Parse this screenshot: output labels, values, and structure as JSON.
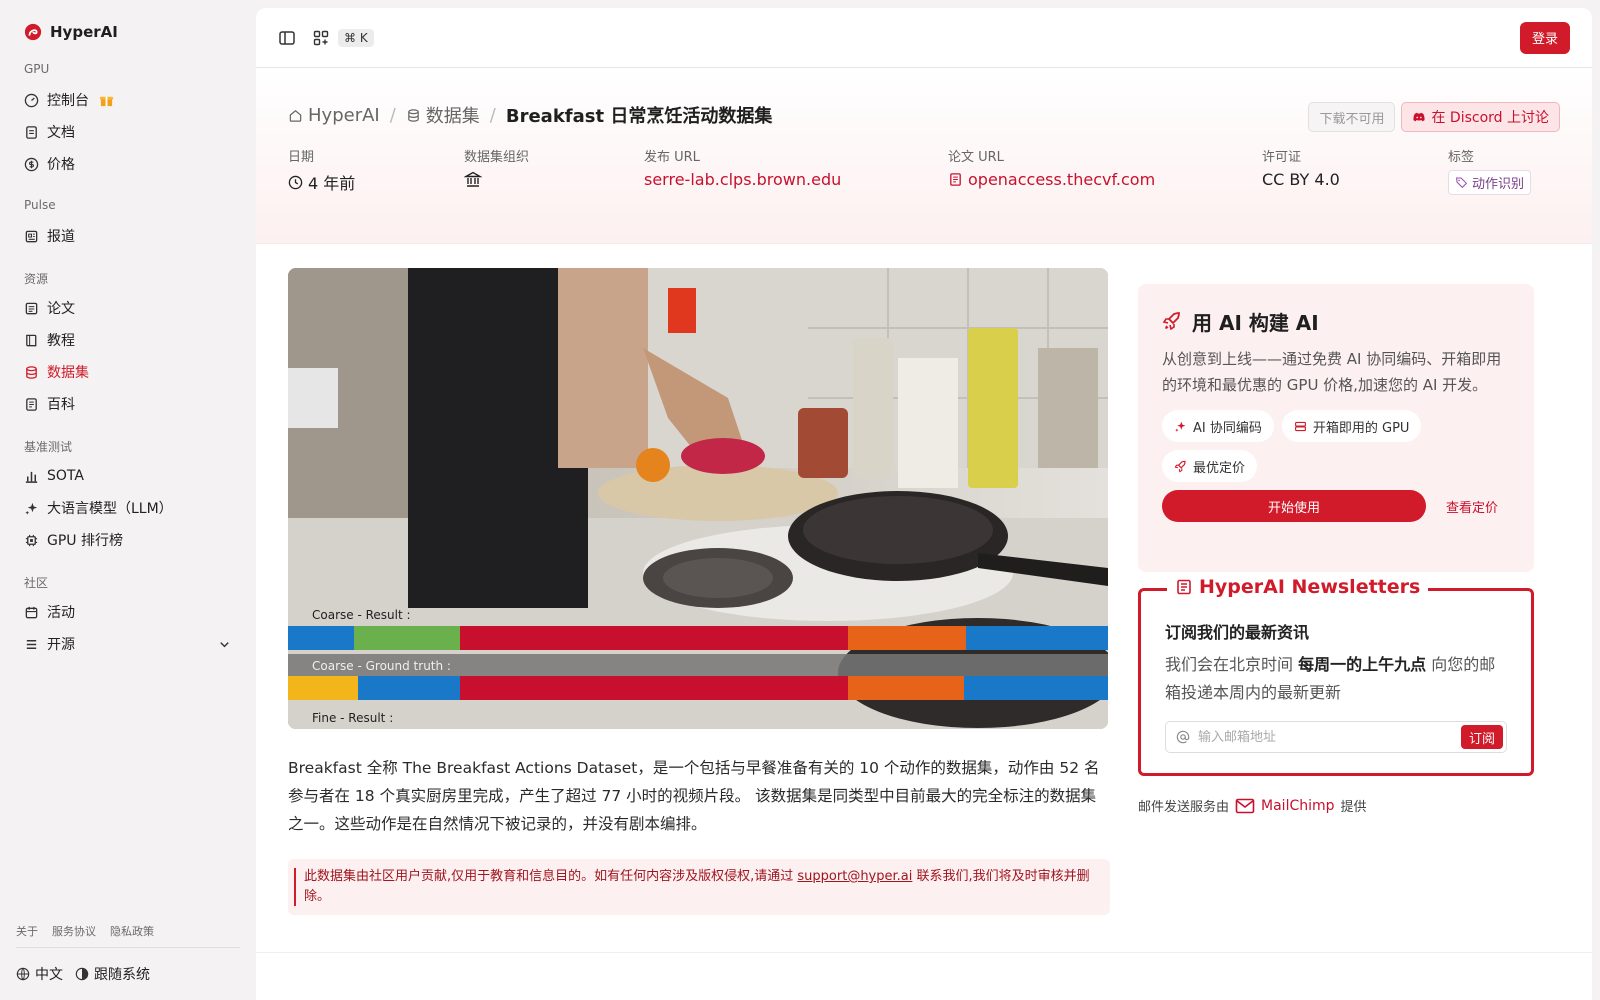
{
  "sidebar": {
    "brand": "HyperAI",
    "groups": [
      {
        "title": "GPU",
        "items": [
          {
            "label": "控制台"
          },
          {
            "label": "文档"
          },
          {
            "label": "价格"
          }
        ]
      },
      {
        "title": "Pulse",
        "items": [
          {
            "label": "报道"
          }
        ]
      },
      {
        "title": "资源",
        "items": [
          {
            "label": "论文"
          },
          {
            "label": "教程"
          },
          {
            "label": "数据集"
          },
          {
            "label": "百科"
          }
        ]
      },
      {
        "title": "基准测试",
        "items": [
          {
            "label": "SOTA"
          },
          {
            "label": "大语言模型（LLM）"
          },
          {
            "label": "GPU 排行榜"
          }
        ]
      },
      {
        "title": "社区",
        "items": [
          {
            "label": "活动"
          },
          {
            "label": "开源"
          }
        ]
      }
    ],
    "footer_links": [
      "关于",
      "服务协议",
      "隐私政策"
    ],
    "language": "中文",
    "theme": "跟随系统"
  },
  "topbar": {
    "shortcut": "⌘ K",
    "login": "登录"
  },
  "hero": {
    "breadcrumb": [
      "HyperAI",
      "数据集",
      "Breakfast 日常烹饪活动数据集"
    ],
    "separator": "/",
    "download_label": "下载不可用",
    "discord_label": "在 Discord 上讨论",
    "meta": {
      "date_label": "日期",
      "date_value": "4 年前",
      "org_label": "数据集组织",
      "publish_label": "发布 URL",
      "publish_value": "serre-lab.clps.brown.edu",
      "paper_label": "论文 URL",
      "paper_value": "openaccess.thecvf.com",
      "license_label": "许可证",
      "license_value": "CC BY 4.0",
      "tags_label": "标签",
      "tag_value": "动作识别"
    }
  },
  "preview": {
    "labels": [
      "Coarse - Result :",
      "Coarse - Ground truth :",
      "Fine - Result :"
    ],
    "colors": [
      "#1a78c8",
      "#6ab04c",
      "#c8102e",
      "#e8631a",
      "#f2b61b",
      "#777777"
    ]
  },
  "description": "Breakfast 全称 The Breakfast Actions Dataset，是一个包括与早餐准备有关的 10 个动作的数据集，动作由 52 名参与者在 18 个真实厨房里完成，产生了超过 77 小时的视频片段。 该数据集是同类型中目前最大的完全标注的数据集之一。这些动作是在自然情况下被记录的，并没有剧本编排。",
  "notice": {
    "text_before": "此数据集由社区用户贡献,仅用于教育和信息目的。如有任何内容涉及版权侵权,请通过 ",
    "email": "support@hyper.ai",
    "text_after": " 联系我们,我们将及时审核并删除。"
  },
  "promo": {
    "title": "用 AI 构建 AI",
    "text": "从创意到上线——通过免费 AI 协同编码、开箱即用的环境和最优惠的 GPU 价格,加速您的 AI 开发。",
    "chips": [
      "AI 协同编码",
      "开箱即用的 GPU",
      "最优定价"
    ],
    "start": "开始使用",
    "pricing": "查看定价"
  },
  "newsletter": {
    "title": "HyperAI Newsletters",
    "heading": "订阅我们的最新资讯",
    "text_before": "我们会在北京时间 ",
    "text_bold": "每周一的上午九点",
    "text_after": " 向您的邮箱投递本周内的最新更新",
    "placeholder": "输入邮箱地址",
    "subscribe": "订阅",
    "footer_before": "邮件发送服务由",
    "provider": "MailChimp",
    "footer_after": "提供"
  },
  "colors": {
    "accent": "#d11a2a",
    "sidebar_bg": "#f4f2f2",
    "hero_tint": "#fdf0f0"
  }
}
